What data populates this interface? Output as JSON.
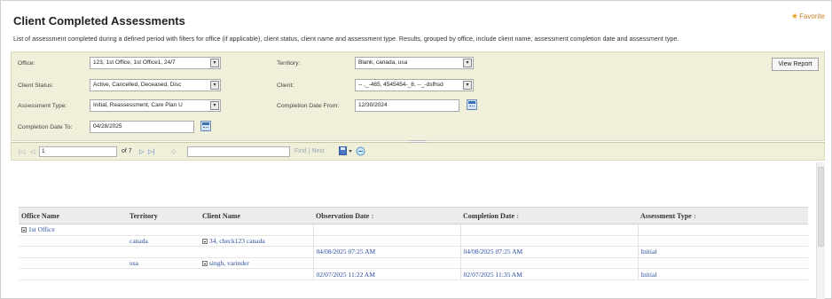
{
  "page": {
    "title": "Client Completed Assessments",
    "favorite_label": "Favorite",
    "description": "List of assessment completed during a defined period with filters for office (if applicable), client status, client name and assessment type. Results, grouped by office, include client name, assessment completion date and assessment type."
  },
  "params": {
    "office_label": "Office:",
    "office_value": "123, 1st Office, 1st Office1, 24/7",
    "territory_label": "Territory:",
    "territory_value": "Blank, canada, usa",
    "client_status_label": "Client Status:",
    "client_status_value": "Active, Cancelled, Deceased, Disc",
    "client_label": "Client:",
    "client_value": "-- ,_-465, 4545454-_8, --_-dsfhsd",
    "assessment_type_label": "Assessment Type:",
    "assessment_type_value": "Initial, Reassessment, Care Plan U",
    "completion_from_label": "Completion Date From:",
    "completion_from_value": "12/30/2024",
    "completion_to_label": "Completion Date To:",
    "completion_to_value": "04/28/2025",
    "view_report_label": "View Report"
  },
  "toolbar": {
    "first": "|◁",
    "prev": "◁",
    "page_value": "1",
    "of_pages": "of 7",
    "next": "▷",
    "last": "▷|",
    "refresh_glyph": "◇",
    "find_next_label": "Find | Next"
  },
  "table": {
    "headers": {
      "office_name": "Office Name",
      "territory": "Territory",
      "client_name": "Client Name",
      "observation_date": "Observation Date",
      "completion_date": "Completion Date",
      "assessment_type": "Assessment Type"
    },
    "sort_glyph": "↕",
    "office_group": "1st Office",
    "rows": [
      {
        "territory": "canada",
        "client": "34, check123 canada",
        "observation": "",
        "completion": "",
        "type": ""
      },
      {
        "territory": "",
        "client": "",
        "observation": "04/08/2025 07:25 AM",
        "completion": "04/08/2025 07:25 AM",
        "type": "Initial"
      },
      {
        "territory": "usa",
        "client": "singh, varinder",
        "observation": "",
        "completion": "",
        "type": ""
      },
      {
        "territory": "",
        "client": "",
        "observation": "02/07/2025 11:22 AM",
        "completion": "02/07/2025 11:35 AM",
        "type": "Initial"
      }
    ]
  },
  "colors": {
    "param_bg": "#f0efd9",
    "link_blue": "#2b4fa0",
    "header_bg": "#ececec",
    "favorite_star": "#e8a21f"
  }
}
